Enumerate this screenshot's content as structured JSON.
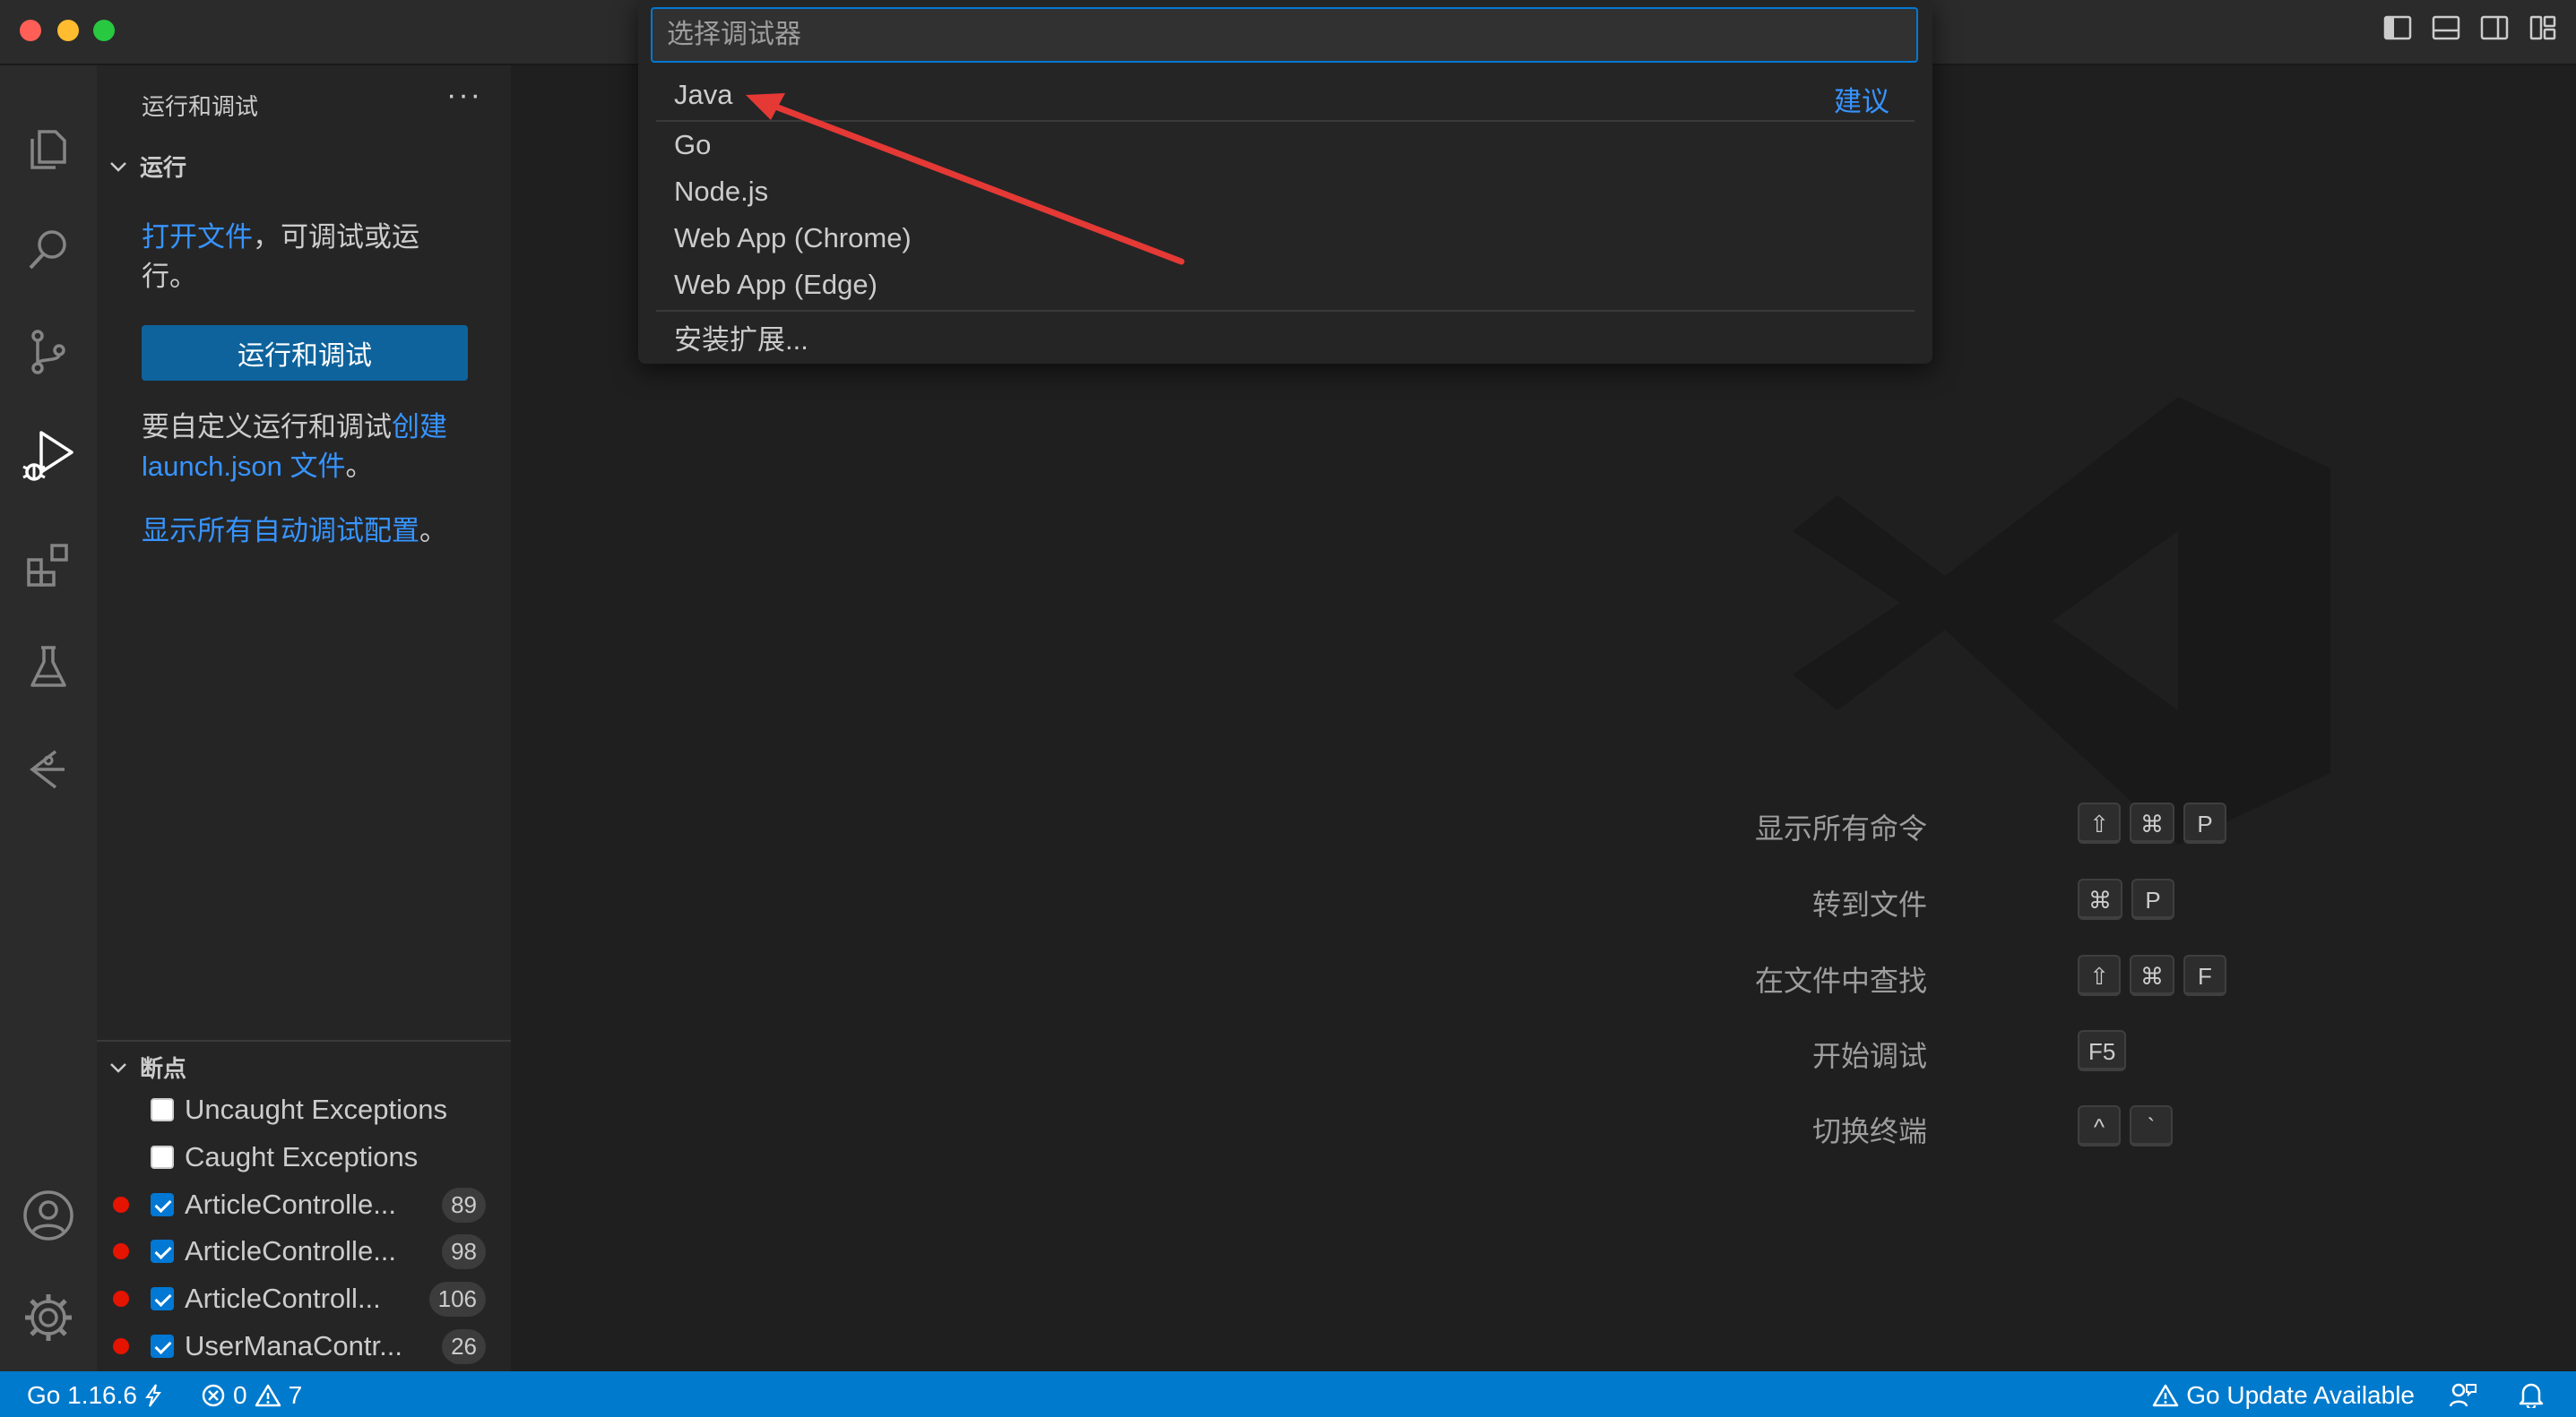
{
  "quick_pick": {
    "placeholder": "选择调试器",
    "items": [
      "Java",
      "Go",
      "Node.js",
      "Web App (Chrome)",
      "Web App (Edge)",
      "安装扩展..."
    ],
    "suggest_label": "建议"
  },
  "sidebar": {
    "title": "运行和调试",
    "more": "···",
    "run_section": "运行",
    "open_file_link": "打开文件",
    "open_file_rest": "，可调试或运行。",
    "run_button": "运行和调试",
    "custom_text": "要自定义运行和调试",
    "create_link": "创建 launch.json 文件",
    "period": "。",
    "show_all_link": "显示所有自动调试配置",
    "breakpoints_section": "断点",
    "breakpoints": [
      {
        "label": "Uncaught Exceptions",
        "checked": false,
        "count": ""
      },
      {
        "label": "Caught Exceptions",
        "checked": false,
        "count": ""
      },
      {
        "label": "ArticleControlle...",
        "checked": true,
        "count": "89"
      },
      {
        "label": "ArticleControlle...",
        "checked": true,
        "count": "98"
      },
      {
        "label": "ArticleControll...",
        "checked": true,
        "count": "106"
      },
      {
        "label": "UserManaContr...",
        "checked": true,
        "count": "26"
      }
    ]
  },
  "shortcuts": [
    {
      "label": "显示所有命令",
      "keys": [
        "⇧",
        "⌘",
        "P"
      ]
    },
    {
      "label": "转到文件",
      "keys": [
        "⌘",
        "P"
      ]
    },
    {
      "label": "在文件中查找",
      "keys": [
        "⇧",
        "⌘",
        "F"
      ]
    },
    {
      "label": "开始调试",
      "keys": [
        "F5"
      ]
    },
    {
      "label": "切换终端",
      "keys": [
        "^",
        "`"
      ]
    }
  ],
  "status": {
    "go_version": "Go 1.16.6",
    "errors": "0",
    "warnings": "7",
    "go_update": "Go Update Available"
  },
  "colors": {
    "accent": "#007acc",
    "link": "#3794ff",
    "breakpoint": "#e51400",
    "arrow": "#e53935"
  }
}
